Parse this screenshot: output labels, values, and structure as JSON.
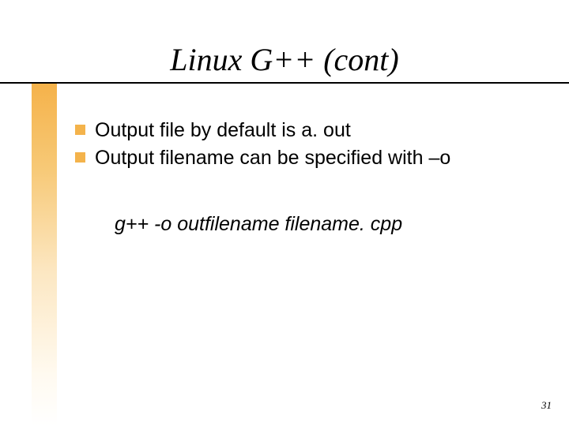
{
  "title": "Linux G++ (cont)",
  "bullets": [
    "Output file by default is  a. out",
    "Output filename can be specified with –o"
  ],
  "command": "g++  -o  outfilename  filename. cpp",
  "page_number": "31"
}
